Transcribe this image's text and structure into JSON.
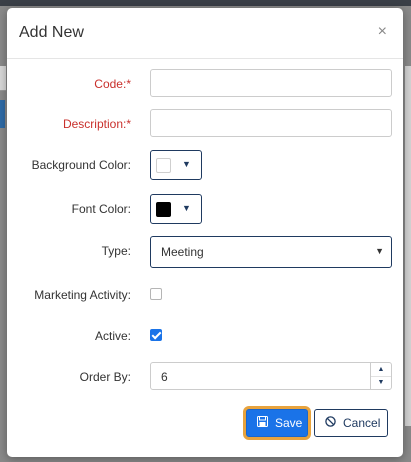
{
  "dialog": {
    "title": "Add New",
    "close_glyph": "×"
  },
  "form": {
    "code": {
      "label": "Code:*",
      "value": "",
      "placeholder": ""
    },
    "description": {
      "label": "Description:*",
      "value": "",
      "placeholder": ""
    },
    "background_color": {
      "label": "Background Color:",
      "swatch": "#ffffff"
    },
    "font_color": {
      "label": "Font Color:",
      "swatch": "#000000"
    },
    "type": {
      "label": "Type:",
      "value": "Meeting"
    },
    "marketing_activity": {
      "label": "Marketing Activity:",
      "checked": false
    },
    "active": {
      "label": "Active:",
      "checked": true
    },
    "order_by": {
      "label": "Order By:",
      "value": "6"
    }
  },
  "actions": {
    "save_label": "Save",
    "cancel_label": "Cancel"
  },
  "icons": {
    "caret": "▼",
    "step_up": "▲",
    "step_down": "▼",
    "save": "floppy-disk-icon",
    "cancel": "ban-icon"
  },
  "colors": {
    "primary": "#1a73e8",
    "required_label": "#c9302c",
    "focus_outline": "#e8a33d",
    "border_dark": "#1f3a60"
  }
}
